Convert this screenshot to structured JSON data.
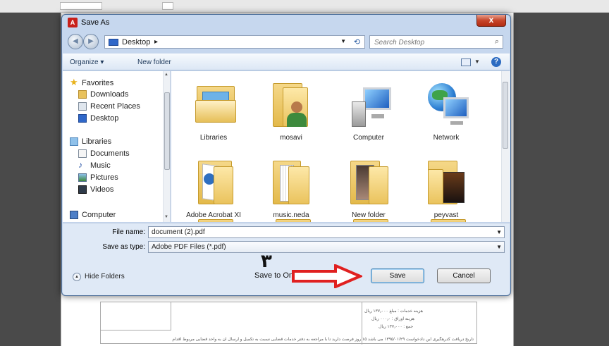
{
  "dialog": {
    "title": "Save As",
    "close_glyph": "x"
  },
  "address": {
    "location": "Desktop",
    "search_placeholder": "Search Desktop"
  },
  "commands": {
    "organize": "Organize ▾",
    "new_folder": "New folder"
  },
  "nav": {
    "items": [
      {
        "label": "Favorites",
        "icon": "star-icon"
      },
      {
        "label": "Downloads",
        "icon": "downloads-folder-icon"
      },
      {
        "label": "Recent Places",
        "icon": "recent-places-icon"
      },
      {
        "label": "Desktop",
        "icon": "desktop-icon"
      },
      {
        "label": "Libraries",
        "icon": "libraries-icon"
      },
      {
        "label": "Documents",
        "icon": "documents-icon"
      },
      {
        "label": "Music",
        "icon": "music-icon"
      },
      {
        "label": "Pictures",
        "icon": "pictures-icon"
      },
      {
        "label": "Videos",
        "icon": "videos-icon"
      },
      {
        "label": "Computer",
        "icon": "computer-icon"
      }
    ]
  },
  "files": {
    "items": [
      {
        "name": "Libraries",
        "icon": "libraries-folder-icon"
      },
      {
        "name": "mosavi",
        "icon": "user-folder-icon"
      },
      {
        "name": "Computer",
        "icon": "computer-icon"
      },
      {
        "name": "Network",
        "icon": "network-globe-icon"
      },
      {
        "name": "Adobe Acrobat XI",
        "icon": "folder-icon"
      },
      {
        "name": "music.neda",
        "icon": "folder-icon"
      },
      {
        "name": "New folder",
        "icon": "folder-icon"
      },
      {
        "name": "peyvast",
        "icon": "folder-icon"
      }
    ]
  },
  "fields": {
    "file_name_label": "File name:",
    "file_name_value": "document (2).pdf",
    "save_type_label": "Save as type:",
    "save_type_value": "Adobe PDF Files (*.pdf)"
  },
  "bottom": {
    "hide_folders": "Hide Folders",
    "online_account": "Save to Online Account",
    "save": "Save",
    "cancel": "Cancel"
  },
  "annotation": {
    "step_number": "۳",
    "arrow_color": "#e02020"
  },
  "pdf_background": {
    "lines": [
      "هزینه خدمات : مبلغ ۱۳۷٫۰۰۰ ریال",
      "هزینه اوراق : ۰۰۰٫۰ ریال",
      "جمع : ۱۳۷٫۰۰۰ ریال",
      "تاریخ دریافت کدرهگیری این دادخواست ۱۳۹۵/۰۱/۲۹ می باشد ۱۵ روز فرصت دارید تا با مراجعه به دفتر خدمات قضایی نسبت به تکمیل و ارسال آن به واحد قضایی مربوط اقدام"
    ]
  }
}
